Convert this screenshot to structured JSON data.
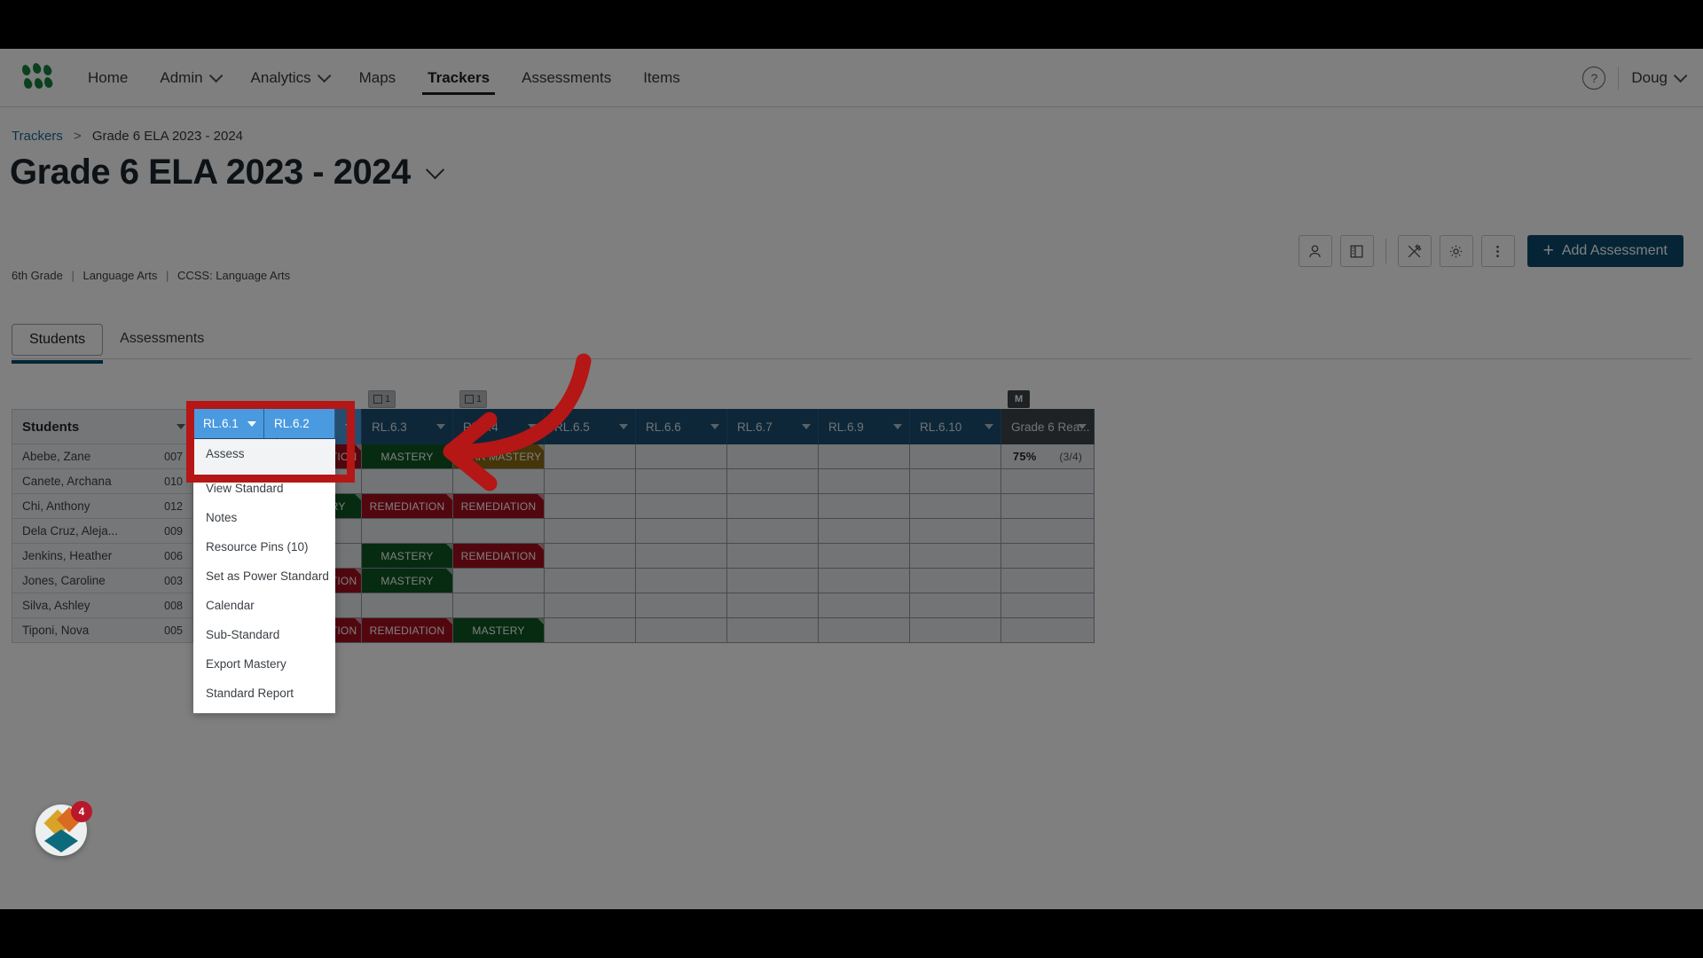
{
  "nav": {
    "logo_icon": "learning-dots-logo",
    "items": [
      {
        "label": "Home",
        "has_caret": false,
        "active": false
      },
      {
        "label": "Admin",
        "has_caret": true,
        "active": false
      },
      {
        "label": "Analytics",
        "has_caret": true,
        "active": false
      },
      {
        "label": "Maps",
        "has_caret": false,
        "active": false
      },
      {
        "label": "Trackers",
        "has_caret": false,
        "active": true
      },
      {
        "label": "Assessments",
        "has_caret": false,
        "active": false
      },
      {
        "label": "Items",
        "has_caret": false,
        "active": false
      }
    ],
    "help_icon": "question-mark-icon",
    "user": "Doug"
  },
  "breadcrumb": {
    "root": "Trackers",
    "separator": ">",
    "current": "Grade 6 ELA 2023 - 2024"
  },
  "header": {
    "title": "Grade 6 ELA 2023 - 2024",
    "subtitle_parts": [
      "6th Grade",
      "Language Arts",
      "CCSS: Language Arts"
    ],
    "subtitle": "6th Grade | Language Arts | CCSS: Language Arts"
  },
  "toolbar": {
    "buttons": [
      {
        "name": "student-icon",
        "glyph": "person"
      },
      {
        "name": "book-panel-icon",
        "glyph": "book"
      },
      {
        "name": "pencil-ruler-icon",
        "glyph": "tools"
      },
      {
        "name": "gear-icon",
        "glyph": "gear"
      },
      {
        "name": "more-vertical-icon",
        "glyph": "kebab"
      }
    ],
    "add_assessment_label": "Add Assessment",
    "add_icon": "plus-icon",
    "accent_color": "#0b4a6f"
  },
  "tabs": [
    {
      "label": "Students",
      "active": true
    },
    {
      "label": "Assessments",
      "active": false
    }
  ],
  "grid": {
    "student_column_header": "Students",
    "columns": [
      {
        "label": "RL.6.1",
        "state": "highlighted",
        "badge": null
      },
      {
        "label": "RL.6.2",
        "state": "highlighted",
        "badge": null
      },
      {
        "label": "RL.6.3",
        "state": "normal",
        "badge": "1"
      },
      {
        "label": "RL.6.4",
        "state": "normal",
        "badge": "1"
      },
      {
        "label": "RL.6.5",
        "state": "normal",
        "badge": null
      },
      {
        "label": "RL.6.6",
        "state": "normal",
        "badge": null
      },
      {
        "label": "RL.6.7",
        "state": "normal",
        "badge": null
      },
      {
        "label": "RL.6.9",
        "state": "normal",
        "badge": null
      },
      {
        "label": "RL.6.10",
        "state": "normal",
        "badge": null
      },
      {
        "label": "Grade 6 Rea...",
        "state": "aggregate",
        "badge": "M"
      }
    ],
    "rows": [
      {
        "name": "Abebe, Zane",
        "id": "007",
        "cells": [
          "",
          "REMEDIATION",
          "MASTERY",
          "NEAR MASTERY",
          "",
          "",
          "",
          "",
          ""
        ],
        "aggregate": {
          "percent": "75%",
          "fraction": "(3/4)"
        }
      },
      {
        "name": "Canete, Archana",
        "id": "010",
        "cells": [
          "",
          "",
          "",
          "",
          "",
          "",
          "",
          "",
          ""
        ],
        "aggregate": null
      },
      {
        "name": "Chi, Anthony",
        "id": "012",
        "cells": [
          "",
          "MASTERY",
          "REMEDIATION",
          "REMEDIATION",
          "",
          "",
          "",
          "",
          ""
        ],
        "aggregate": null
      },
      {
        "name": "Dela Cruz, Aleja...",
        "id": "009",
        "cells": [
          "",
          "",
          "",
          "",
          "",
          "",
          "",
          "",
          ""
        ],
        "aggregate": null
      },
      {
        "name": "Jenkins, Heather",
        "id": "006",
        "cells": [
          "",
          "",
          "MASTERY",
          "REMEDIATION",
          "",
          "",
          "",
          "",
          ""
        ],
        "aggregate": null
      },
      {
        "name": "Jones, Caroline",
        "id": "003",
        "cells": [
          "",
          "REMEDIATION",
          "MASTERY",
          "",
          "",
          "",
          "",
          "",
          ""
        ],
        "aggregate": null
      },
      {
        "name": "Silva, Ashley",
        "id": "008",
        "cells": [
          "",
          "",
          "",
          "",
          "",
          "",
          "",
          "",
          ""
        ],
        "aggregate": null
      },
      {
        "name": "Tiponi, Nova",
        "id": "005",
        "cells": [
          "",
          "REMEDIATION",
          "REMEDIATION",
          "MASTERY",
          "",
          "",
          "",
          "",
          ""
        ],
        "aggregate": null
      }
    ],
    "status_colors": {
      "MASTERY": "#0d5622",
      "REMEDIATION": "#a50f1e",
      "NEAR MASTERY": "#8a6a12",
      "empty": "#e6e9eb"
    }
  },
  "context_menu": {
    "items": [
      "Assess",
      "View Standard",
      "Notes",
      "Resource Pins (10)",
      "Set as Power Standard",
      "Calendar",
      "Sub-Standard",
      "Export Mastery",
      "Standard Report"
    ],
    "highlighted_item": "Assess"
  },
  "annotation": {
    "box_color": "#b51616",
    "arrow_color": "#b51616",
    "arrow_name": "red-callout-arrow",
    "box_name": "red-callout-box"
  },
  "chat_widget": {
    "badge_count": "4",
    "icon": "chat-diamond-logo"
  }
}
